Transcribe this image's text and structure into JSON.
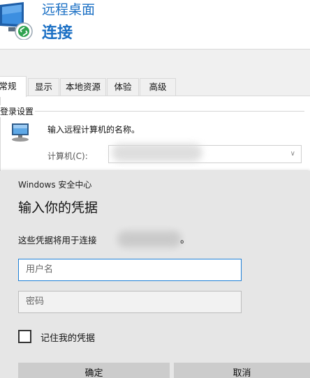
{
  "rdp": {
    "title": "远程桌面",
    "subtitle": "连接",
    "tabs": [
      "常规",
      "显示",
      "本地资源",
      "体验",
      "高级"
    ],
    "active_tab_index": 0,
    "group_label": "登录设置",
    "hint": "输入远程计算机的名称。",
    "computer_label": "计算机(C):",
    "computer_value": ""
  },
  "credential": {
    "header": "Windows 安全中心",
    "title": "输入你的凭据",
    "description": "这些凭据将用于连接",
    "description_suffix": "。",
    "username_placeholder": "用户名",
    "password_placeholder": "密码",
    "remember_label": "记住我的凭据",
    "remember_checked": false,
    "ok_label": "确定",
    "cancel_label": "取消"
  },
  "colors": {
    "accent": "#1a6fc4",
    "focus_border": "#1e7fd6",
    "dialog_bg": "#e6e6e6",
    "button_bg": "#cccccc"
  }
}
